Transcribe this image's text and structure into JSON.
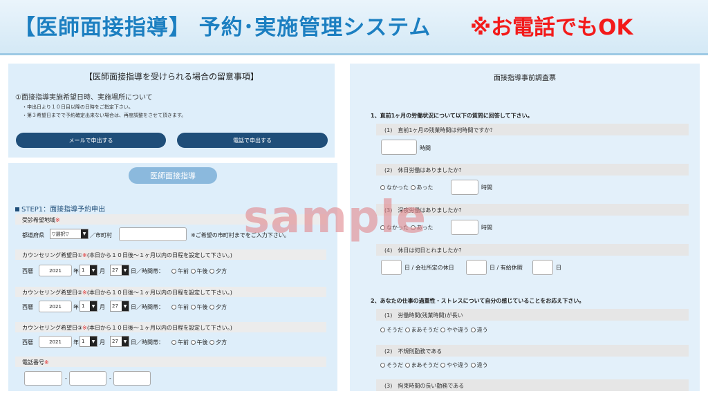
{
  "title": {
    "main": "【医師面接指導】 予約･実施管理システム",
    "ok": "※お電話でもOK"
  },
  "notice": {
    "title": "【医師面接指導を受けられる場合の留意事項】",
    "subtitle": "①面接指導実施希望日時、実施場所について",
    "bullet1": "・申出日より１０日目以降の日時をご指定下さい。",
    "bullet2": "・第３希望日までで予約確定出来ない場合は、再度調整をさせて頂きます。",
    "mail_button": "メールで申出する",
    "tel_button": "電話で申出する"
  },
  "form": {
    "header": "医師面接指導",
    "step": "STEP1：面接指導予約申出",
    "area_label": "受診希望地域",
    "required_mark": "※",
    "pref_label": "都道府県",
    "pref_select": "▽選択▽",
    "city_label": "／市町村",
    "city_hint": "※ご希望の市町村までをご入力下さい。",
    "counseling": [
      {
        "label": "カウンセリング希望日①",
        "note": "(本日から１０日後〜１ヶ月以内の日程を設定して下さい。)"
      },
      {
        "label": "カウンセリング希望日②",
        "note": "(本日から１０日後〜１ヶ月以内の日程を設定して下さい。)"
      },
      {
        "label": "カウンセリング希望日③",
        "note": "(本日から１０日後〜１ヶ月以内の日程を設定して下さい。)"
      }
    ],
    "era": "西暦",
    "year": "2021",
    "year_unit": "年",
    "month": "1",
    "month_unit": "月",
    "day": "27",
    "day_unit": "日",
    "time_label": "／時間帯：",
    "time_opts": [
      "午前",
      "午後",
      "夕方"
    ],
    "phone_label": "電話番号",
    "dash": "-"
  },
  "survey": {
    "title": "面接指導事前調査票",
    "section1": "1、直前1ヶ月の労働状況について以下の質問に回答して下さい。",
    "q1": "(1)　直前1ヶ月の残業時間は何時間ですか？",
    "hours": "時間",
    "q2": "(2)　休日労働はありましたか？",
    "q3": "(3)　深夜労働はありましたか？",
    "yes_no": [
      "なかった",
      "あった"
    ],
    "q4": "(4)　休日は何日とれましたか？",
    "days_a": "日 / 会社所定の休日",
    "days_b": "日 / 有給休暇",
    "days_c": "日",
    "section2": "2、あなたの仕事の過重性・ストレスについて自分の感じていることをお応え下さい。",
    "q5": "(1)　労働時間(残業時間)が長い",
    "q6": "(2)　不規則勤務である",
    "q7": "(3)　拘束時間の長い勤務である",
    "scale": [
      "そうだ",
      "まあそうだ",
      "やや違う",
      "違う"
    ]
  },
  "watermark": "sample",
  "colors": {
    "title_blue": "#1c7fc1",
    "title_red": "#f31a1a",
    "button_navy": "#1f4e79",
    "panel_blue": "#deeefa",
    "required_red": "#e02b2b"
  }
}
